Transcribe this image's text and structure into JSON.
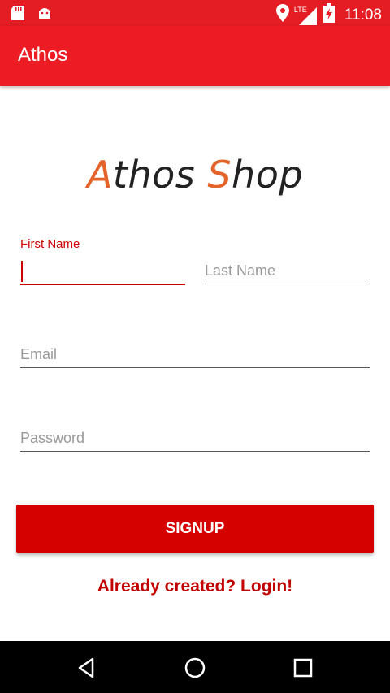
{
  "status_bar": {
    "time": "11:08",
    "network_label": "LTE",
    "icons": [
      "sd-card-icon",
      "android-icon",
      "location-icon",
      "signal-icon",
      "battery-charging-icon"
    ]
  },
  "app_bar": {
    "title": "Athos"
  },
  "logo": {
    "part1": "A",
    "part2": "thos ",
    "part3": "S",
    "part4": "hop"
  },
  "form": {
    "first_name_label": "First Name",
    "first_name_value": "",
    "last_name_placeholder": "Last Name",
    "email_placeholder": "Email",
    "password_placeholder": "Password"
  },
  "actions": {
    "signup_label": "SIGNUP",
    "login_link": "Already created? Login!"
  },
  "nav_bar": {
    "icons": [
      "back-icon",
      "home-icon",
      "recents-icon"
    ]
  },
  "colors": {
    "primary": "#ed1c24",
    "status_bar": "#e31d23",
    "accent": "#d50000",
    "logo_accent": "#e4632a"
  }
}
